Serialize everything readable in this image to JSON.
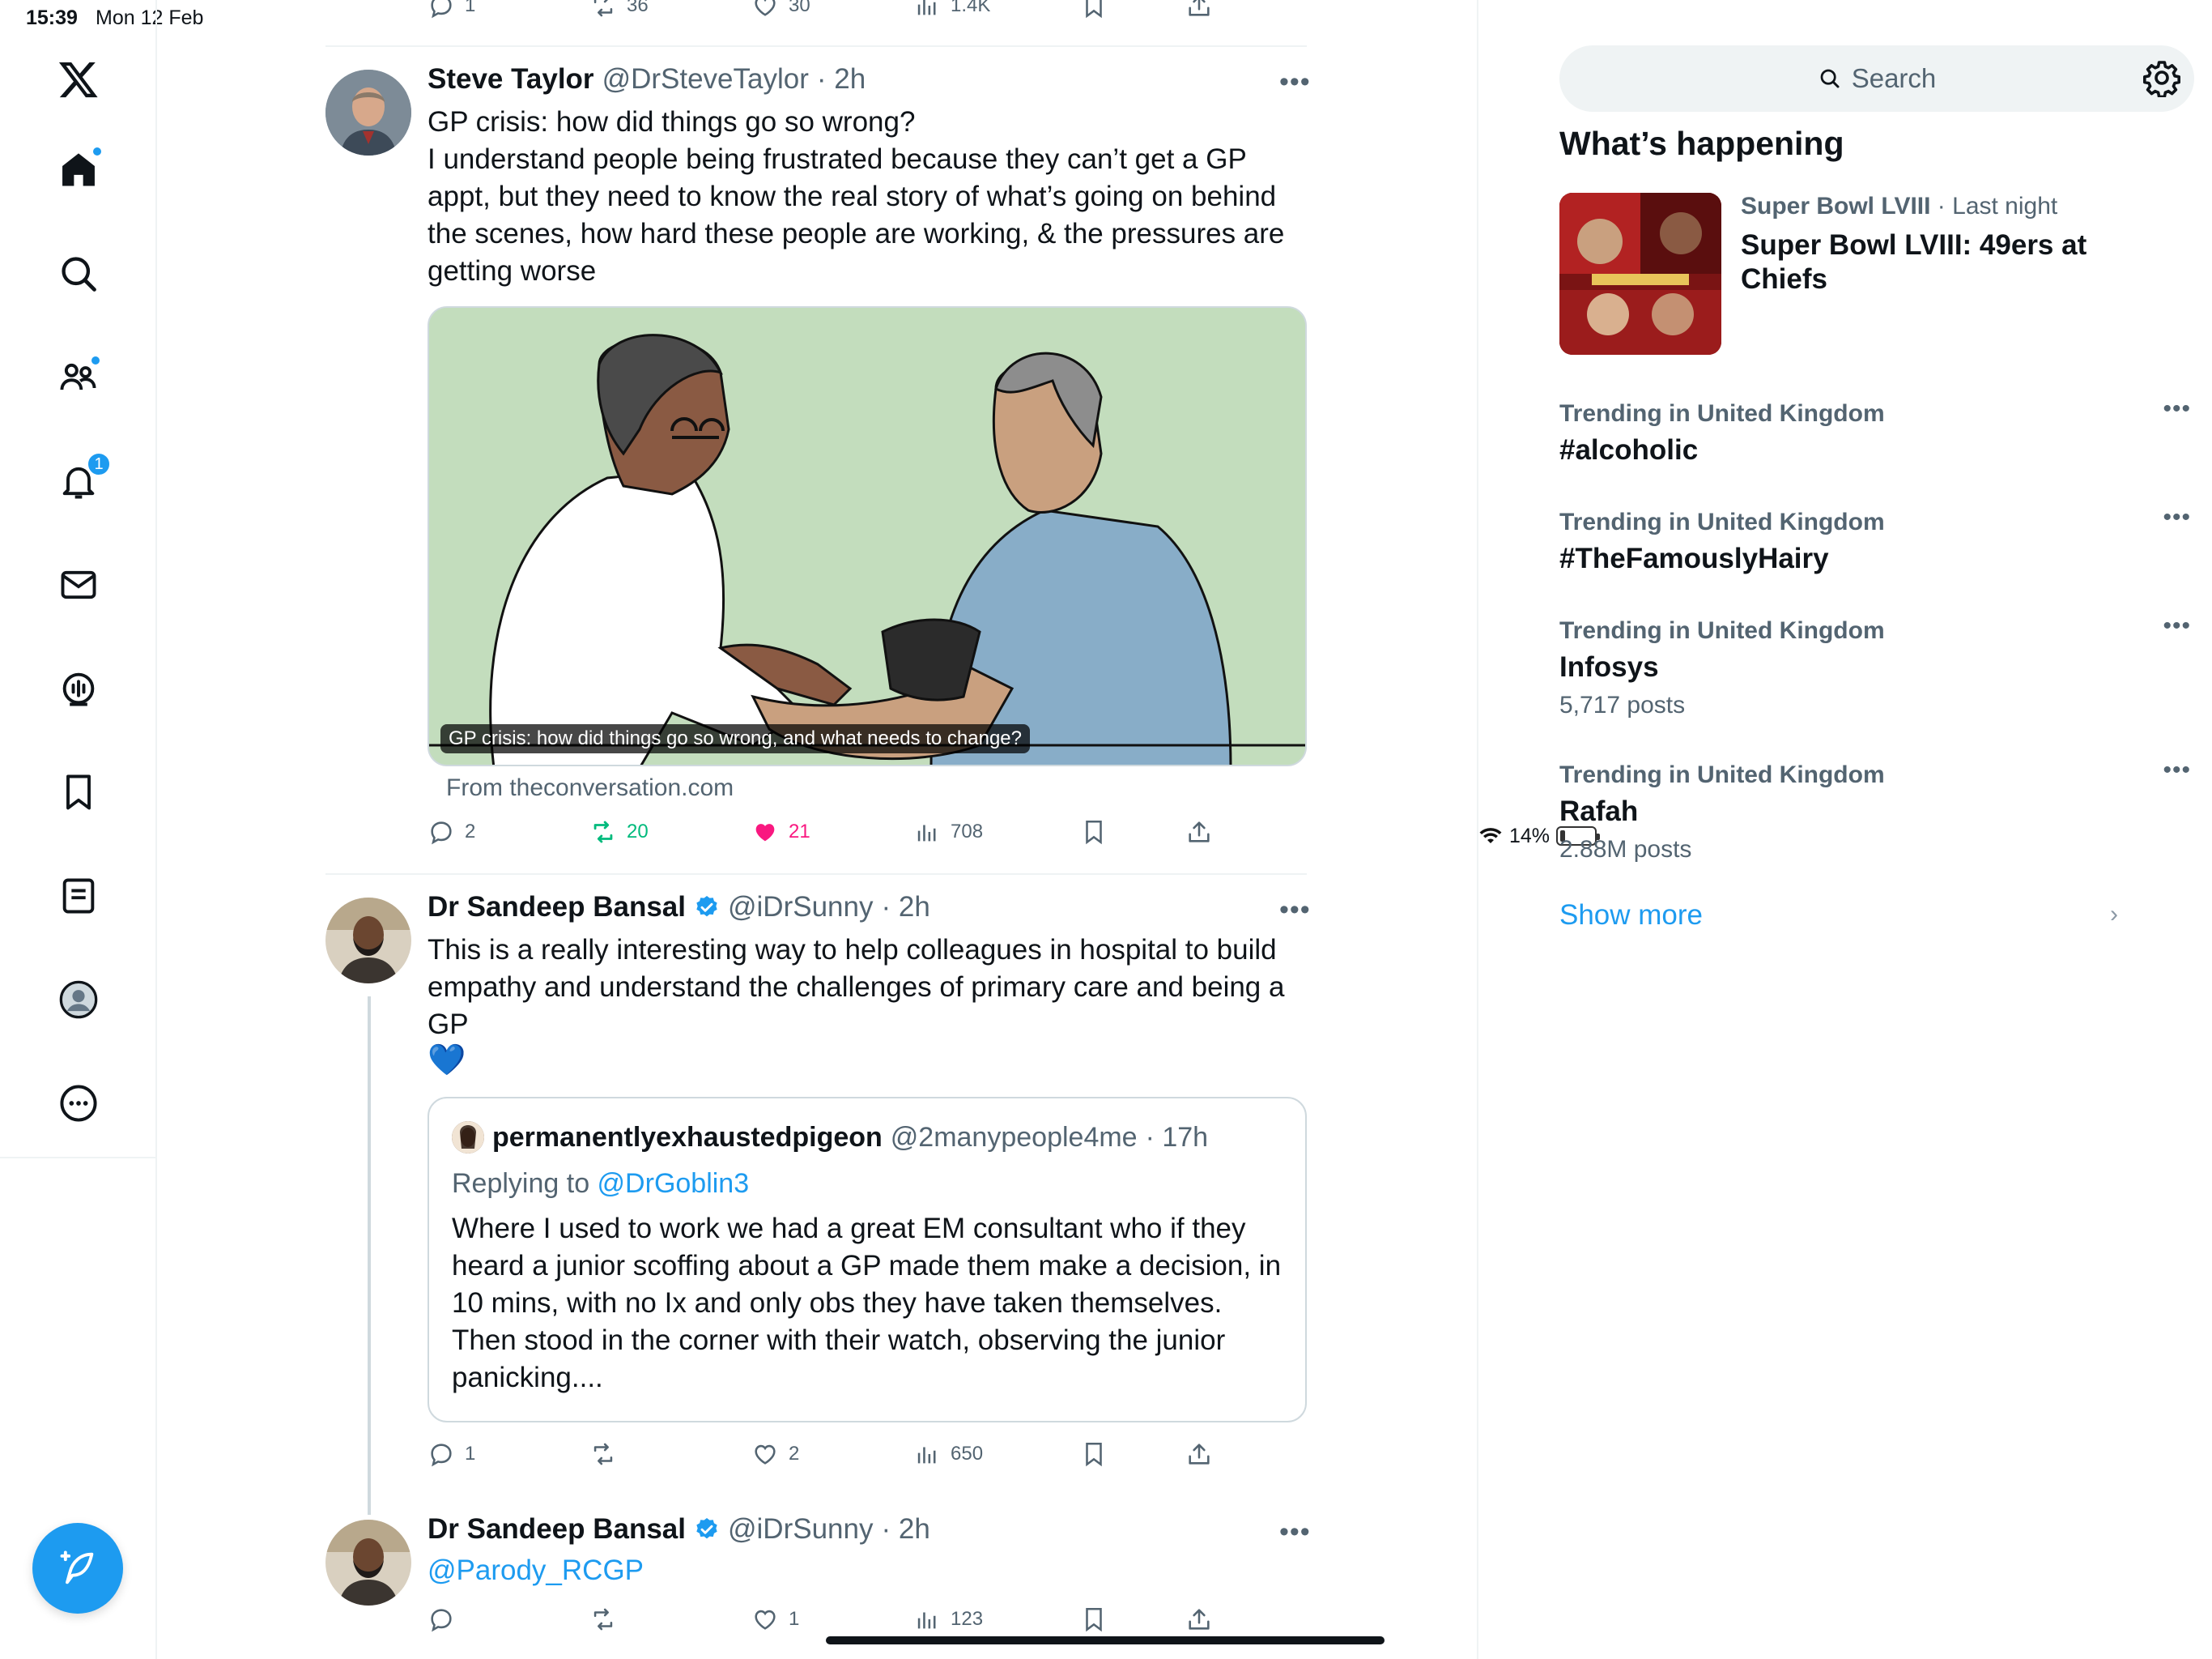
{
  "status": {
    "time": "15:39",
    "date": "Mon 12 Feb",
    "battery": "14%"
  },
  "nav": {
    "items": [
      "logo",
      "home",
      "explore",
      "communities",
      "notifications",
      "messages",
      "spaces",
      "bookmarks",
      "lists",
      "profile",
      "more"
    ],
    "notifications_badge": "1"
  },
  "feed": {
    "prev_tweet": {
      "replies": "1",
      "reposts": "36",
      "likes": "30",
      "views": "1.4K"
    },
    "tweet1": {
      "name": "Steve Taylor",
      "handle": "@DrSteveTaylor",
      "time": "· 2h",
      "text": "GP crisis: how did things go so wrong?\nI understand people being frustrated because they can’t get a GP appt, but they need to know the real story of what’s going on behind the scenes, how hard these people are working, & the pressures are getting worse",
      "card_caption": "GP crisis: how did things go so wrong, and what needs to change?",
      "card_source": "From theconversation.com",
      "replies": "2",
      "reposts": "20",
      "likes": "21",
      "views": "708"
    },
    "tweet2": {
      "name": "Dr Sandeep Bansal",
      "handle": "@iDrSunny",
      "time": "· 2h",
      "text": "This is a really interesting way to help colleagues in hospital to build empathy and understand the challenges of primary care and being a GP",
      "emoji": "💙",
      "quote": {
        "name": "permanentlyexhaustedpigeon",
        "handle": "@2manypeople4me",
        "time": "· 17h",
        "replying_prefix": "Replying to ",
        "replying_to": "@DrGoblin3",
        "text": "Where I used to work we had a great EM consultant who if they heard a junior scoffing about a GP made them make a decision, in 10 mins, with no Ix and only obs they have taken themselves. Then stood in the corner with their watch, observing the junior panicking...."
      },
      "replies": "1",
      "reposts": "",
      "likes": "2",
      "views": "650"
    },
    "tweet3": {
      "name": "Dr Sandeep Bansal",
      "handle": "@iDrSunny",
      "time": "· 2h",
      "mention": "@Parody_RCGP",
      "replies": "",
      "reposts": "",
      "likes": "1",
      "views": "123"
    }
  },
  "sidebar": {
    "search_placeholder": "Search",
    "title": "What’s happening",
    "superbowl": {
      "context": "Super Bowl LVIII",
      "when": " · Last night",
      "title": "Super Bowl LVIII: 49ers at Chiefs"
    },
    "trends": [
      {
        "context": "Trending in United Kingdom",
        "name": "#alcoholic",
        "count": ""
      },
      {
        "context": "Trending in United Kingdom",
        "name": "#TheFamouslyHairy",
        "count": ""
      },
      {
        "context": "Trending in United Kingdom",
        "name": "Infosys",
        "count": "5,717 posts"
      },
      {
        "context": "Trending in United Kingdom",
        "name": "Rafah",
        "count": "2.88M posts"
      }
    ],
    "show_more": "Show more"
  },
  "colors": {
    "accent": "#1d9bf0",
    "like": "#f91880",
    "repost": "#00ba7c"
  }
}
